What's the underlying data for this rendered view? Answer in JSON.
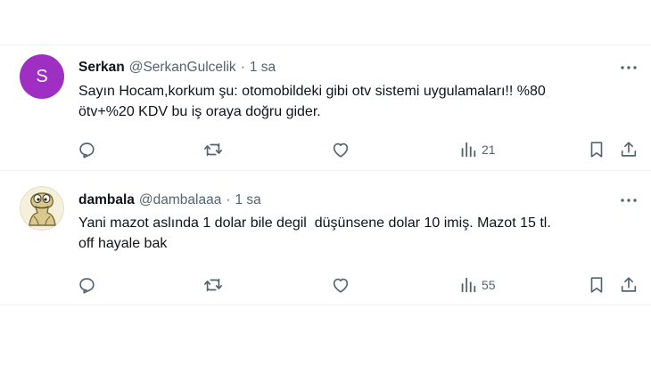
{
  "tweets": [
    {
      "author": "Serkan",
      "handle": "@SerkanGulcelik",
      "separator": "·",
      "time": "1 sa",
      "avatar_letter": "S",
      "avatar_color": "#9f2fc3",
      "text": "Sayın Hocam,korkum şu: otomobildeki gibi otv sistemi uygulamaları!! %80\nötv+%20 KDV bu iş oraya doğru gider.",
      "views": "21"
    },
    {
      "author": "dambala",
      "handle": "@dambalaaa",
      "separator": "·",
      "time": "1 sa",
      "avatar_icon": "cartoon-character-avatar",
      "text": "Yani mazot aslında 1 dolar bile degil  düşünsene dolar 10 imiş. Mazot 15 tl.\noff hayale bak",
      "views": "55"
    }
  ],
  "icons": {
    "reply": "reply-icon",
    "retweet": "retweet-icon",
    "like": "heart-icon",
    "views": "views-chart-icon",
    "bookmark": "bookmark-icon",
    "share": "share-icon",
    "more": "more-options-icon"
  },
  "colors": {
    "text": "#0f1419",
    "secondary": "#536471",
    "divider": "#eff3f4"
  }
}
